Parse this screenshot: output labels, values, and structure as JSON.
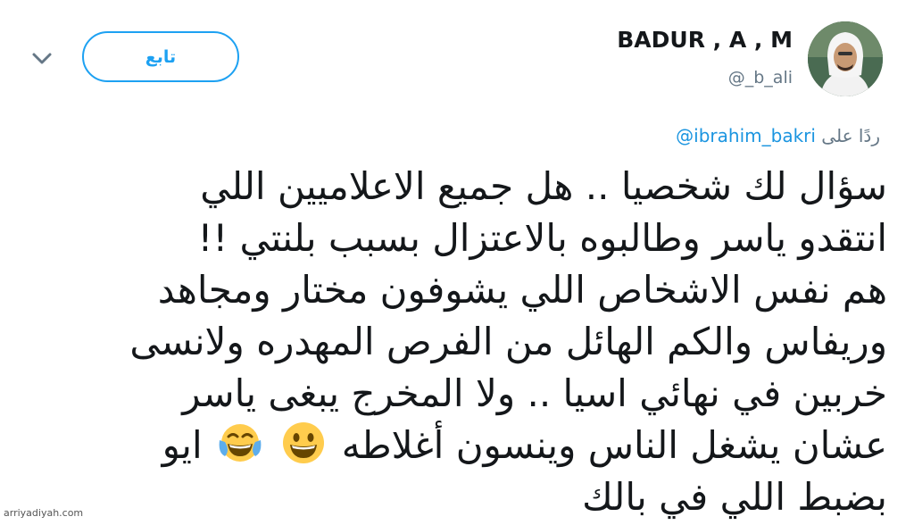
{
  "header": {
    "follow_label": "تابع",
    "display_name": "BADUR , A , M",
    "handle": "@_b_ali",
    "avatar_icon": "user-avatar-photo",
    "menu_icon": "chevron-down-icon"
  },
  "reply": {
    "prefix": "ردًا على",
    "mention": "@ibrahim_bakri"
  },
  "tweet": {
    "lines": [
      "سؤال لك شخصيا .. هل جميع الاعلاميين اللي",
      "انتقدو ياسر وطالبوه بالاعتزال بسبب بلنتي !!",
      "هم نفس الاشخاص اللي يشوفون مختار ومجاهد",
      "وريفاس والكم الهائل من الفرص المهدره ولانسى",
      "خربين في نهائي اسيا .. ولا المخرج  يبغى ياسر",
      "عشان يشغل الناس وينسون أغلاطه",
      "ايو",
      "بضبط اللي في بالك"
    ],
    "emojis": [
      "grinning-face-icon",
      "face-with-tears-of-joy-icon"
    ]
  },
  "watermark": "arriyadiyah.com",
  "colors": {
    "accent": "#1da1f2",
    "mention": "#1b95e0",
    "muted": "#657786",
    "text": "#14171a",
    "emoji_yellow": "#ffcc4d"
  }
}
